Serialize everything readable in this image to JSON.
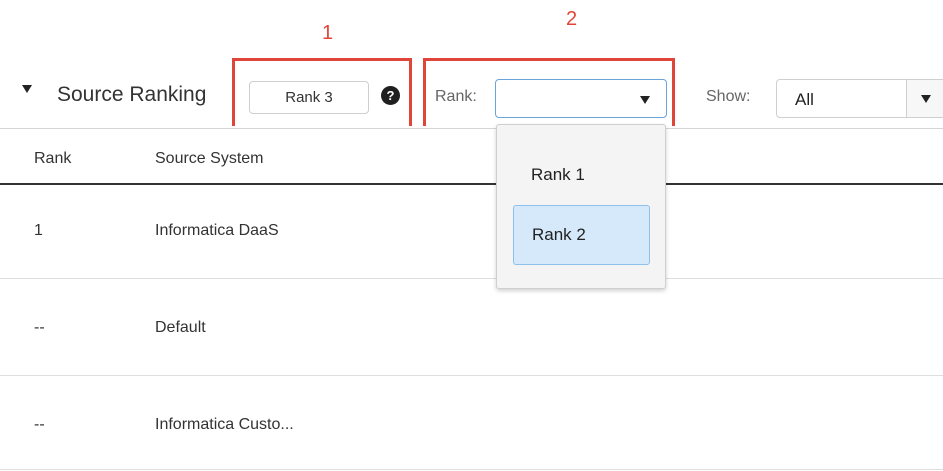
{
  "annotations": {
    "callout_1": "1",
    "callout_2": "2"
  },
  "section": {
    "title": "Source Ranking",
    "rank_badge": "Rank 3",
    "help_icon": "?"
  },
  "filters": {
    "rank_label": "Rank:",
    "rank_value": "",
    "show_label": "Show:",
    "show_value": "All"
  },
  "table": {
    "headers": [
      "Rank",
      "Source System"
    ],
    "rows": [
      {
        "rank": "1",
        "source": "Informatica DaaS"
      },
      {
        "rank": "--",
        "source": "Default"
      },
      {
        "rank": "--",
        "source": "Informatica Custo..."
      }
    ]
  },
  "rank_dropdown": {
    "options": [
      "Rank 1",
      "Rank 2"
    ],
    "highlighted": "Rank 2"
  },
  "colors": {
    "annotation_red": "#e0453a",
    "focus_blue": "#6aa3d8",
    "highlight_bg": "#d5e9fb"
  }
}
